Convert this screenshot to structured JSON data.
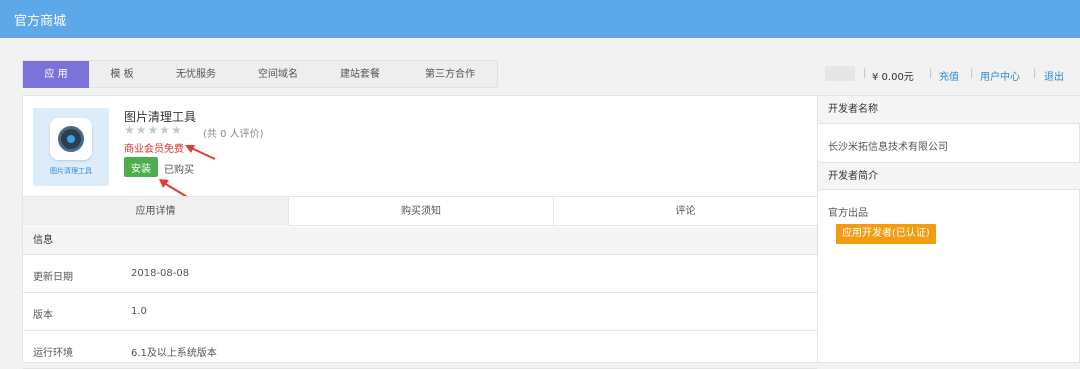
{
  "header": {
    "title": "官方商城"
  },
  "tabs": [
    {
      "label": "应 用",
      "active": true
    },
    {
      "label": "模 板"
    },
    {
      "label": "无忧服务"
    },
    {
      "label": "空间域名"
    },
    {
      "label": "建站套餐"
    },
    {
      "label": "第三方合作"
    }
  ],
  "account": {
    "balance": "¥ 0.00元",
    "separator": "|",
    "recharge": "充值",
    "user_center": "用户中心",
    "logout": "退出"
  },
  "app": {
    "icon_caption": "图片清理工具",
    "name": "图片清理工具",
    "stars": "★★★★★",
    "rating_count": "(共 0 人评价)",
    "price_note": "商业会员免费",
    "install_label": "安装",
    "bought_label": "已购买"
  },
  "detail_tabs": [
    {
      "label": "应用详情",
      "active": true
    },
    {
      "label": "购买须知"
    },
    {
      "label": "评论"
    }
  ],
  "info": {
    "heading": "信息",
    "rows": [
      {
        "key": "更新日期",
        "value": "2018-08-08"
      },
      {
        "key": "版本",
        "value": "1.0"
      },
      {
        "key": "运行环境",
        "value": "6.1及以上系统版本"
      }
    ]
  },
  "developer": {
    "name_heading": "开发者名称",
    "name": "长沙米拓信息技术有限公司",
    "intro_heading": "开发者简介",
    "intro": "官方出品",
    "badge": "应用开发者(已认证)"
  },
  "colors": {
    "header": "#5ca8e8",
    "active_tab": "#7b73d9",
    "install": "#4cae4c",
    "badge": "#f39c12",
    "price_note": "#d9342b",
    "arrow": "#e53935"
  }
}
